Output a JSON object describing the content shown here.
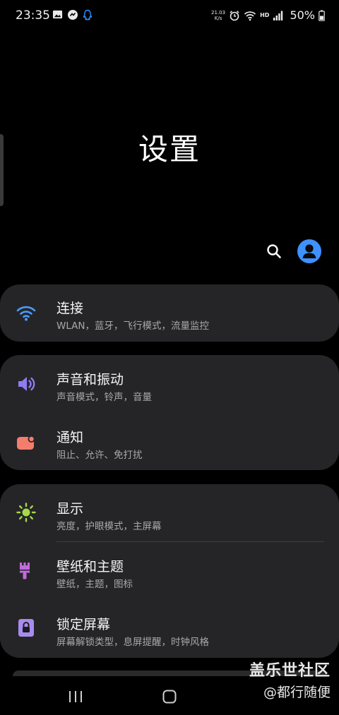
{
  "status_bar": {
    "time": "23:35",
    "speed_value": "21.03",
    "speed_unit": "K/s",
    "network_badge": "HD",
    "battery": "50%",
    "left_icons": [
      "gallery-icon",
      "app-icon",
      "qq-icon"
    ],
    "right_icons": [
      "alarm-icon",
      "wifi-icon",
      "signal-icon",
      "battery-icon"
    ]
  },
  "header": {
    "title": "设置"
  },
  "actions": {
    "search_icon": "search-icon",
    "account_icon": "account-icon"
  },
  "groups": [
    {
      "items": [
        {
          "title": "连接",
          "subtitle": "WLAN，蓝牙，飞行模式，流量监控",
          "icon": "wifi-icon",
          "color": "#4b9bff"
        }
      ]
    },
    {
      "items": [
        {
          "title": "声音和振动",
          "subtitle": "声音模式，铃声，音量",
          "icon": "volume-icon",
          "color": "#8e7cf2"
        },
        {
          "title": "通知",
          "subtitle": "阻止、允许、免打扰",
          "icon": "notification-icon",
          "color": "#f47d6e"
        }
      ]
    },
    {
      "items": [
        {
          "title": "显示",
          "subtitle": "亮度，护眼模式，主屏幕",
          "icon": "brightness-icon",
          "color": "#a6d94a"
        },
        {
          "title": "壁纸和主题",
          "subtitle": "壁纸，主题，图标",
          "icon": "brush-icon",
          "color": "#c16bdb"
        },
        {
          "title": "锁定屏幕",
          "subtitle": "屏幕解锁类型，息屏提醒，时钟风格",
          "icon": "lock-icon",
          "color": "#a78cf0"
        }
      ]
    }
  ],
  "nav": {
    "recents": "recents-icon",
    "home": "home-icon"
  },
  "watermark": {
    "line1": "盖乐世社区",
    "line2": "@都行随便"
  }
}
